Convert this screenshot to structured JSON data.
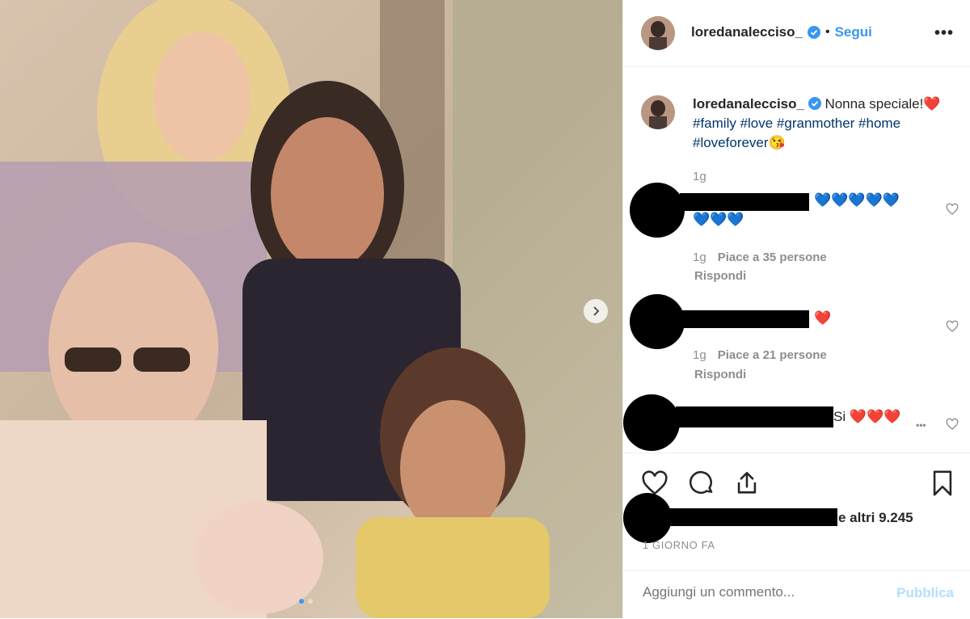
{
  "post": {
    "username": "loredanalecciso_",
    "follow_label": "Segui",
    "more_label": "•••",
    "bullet": "•",
    "caption": {
      "text": "Nonna speciale!❤️",
      "hashtags_line1": "#family #love #granmother #home",
      "hashtags_line2": "#loveforever😘"
    },
    "caption_time": "1g",
    "comments": [
      {
        "text_line1": "💙💙💙💙💙",
        "text_line2": "💙💙💙",
        "time": "1g",
        "likes": "Piace a 35 persone",
        "reply_label": "Rispondi"
      },
      {
        "text_line1": "❤️",
        "time": "1g",
        "likes": "Piace a 21 persone",
        "reply_label": "Rispondi"
      },
      {
        "text_line1": "Si ❤️❤️❤️",
        "more": "•••"
      }
    ],
    "likes_suffix": "e altri 9.245",
    "time_ago": "1 GIORNO FA",
    "add_comment_placeholder": "Aggiungi un commento...",
    "publish_label": "Pubblica"
  },
  "carousel": {
    "current": 1,
    "total": 2
  },
  "icons": {
    "verified": "verified-badge-icon",
    "heart": "heart-icon",
    "comment": "comment-icon",
    "share": "share-icon",
    "save": "bookmark-icon",
    "next": "chevron-right-icon"
  },
  "colors": {
    "accent": "#3897f0",
    "hashtag": "#00376b",
    "muted": "#8e8e8e",
    "verified": "#3897f0"
  }
}
